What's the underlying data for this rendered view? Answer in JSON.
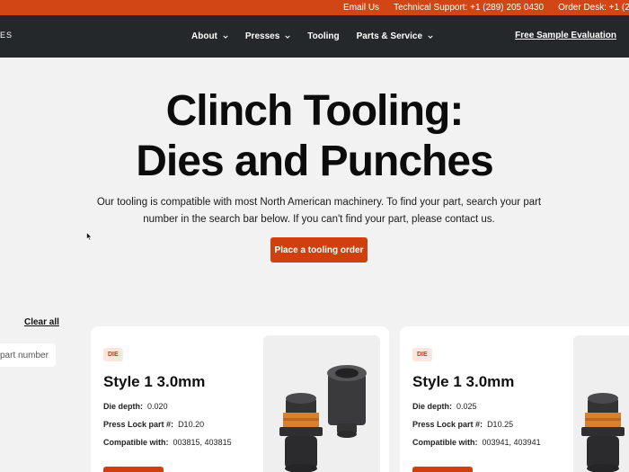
{
  "topbar": {
    "email": "Email Us",
    "support": "Technical Support: +1 (289) 205 0430",
    "order": "Order Desk: +1 (289"
  },
  "nav": {
    "logo_fragment": "ES",
    "items": [
      {
        "label": "About",
        "has_dropdown": true
      },
      {
        "label": "Presses",
        "has_dropdown": true
      },
      {
        "label": "Tooling",
        "has_dropdown": false
      },
      {
        "label": "Parts & Service",
        "has_dropdown": true
      }
    ],
    "cta": "Free Sample Evaluation"
  },
  "hero": {
    "title_line1": "Clinch Tooling:",
    "title_line2": "Dies and Punches",
    "description": "Our tooling is compatible with most North American machinery. To find your part, search your part number in the search bar below. If you can't find your part, please contact us.",
    "button": "Place a tooling order"
  },
  "filters": {
    "clear_all": "Clear all",
    "search_placeholder": "part number"
  },
  "products": [
    {
      "badge": "DIE",
      "title": "Style 1 3.0mm",
      "die_depth_label": "Die depth:",
      "die_depth": "0.020",
      "press_lock_label": "Press Lock part #:",
      "press_lock": "D10.20",
      "compatible_label": "Compatible with:",
      "compatible": "003815, 403815"
    },
    {
      "badge": "DIE",
      "title": "Style 1 3.0mm",
      "die_depth_label": "Die depth:",
      "die_depth": "0.025",
      "press_lock_label": "Press Lock part #:",
      "press_lock": "D10.25",
      "compatible_label": "Compatible with:",
      "compatible": "003941, 403941"
    }
  ],
  "colors": {
    "accent": "#d0400f",
    "nav_bg": "#24282b",
    "page_bg": "#f2f2f2"
  }
}
